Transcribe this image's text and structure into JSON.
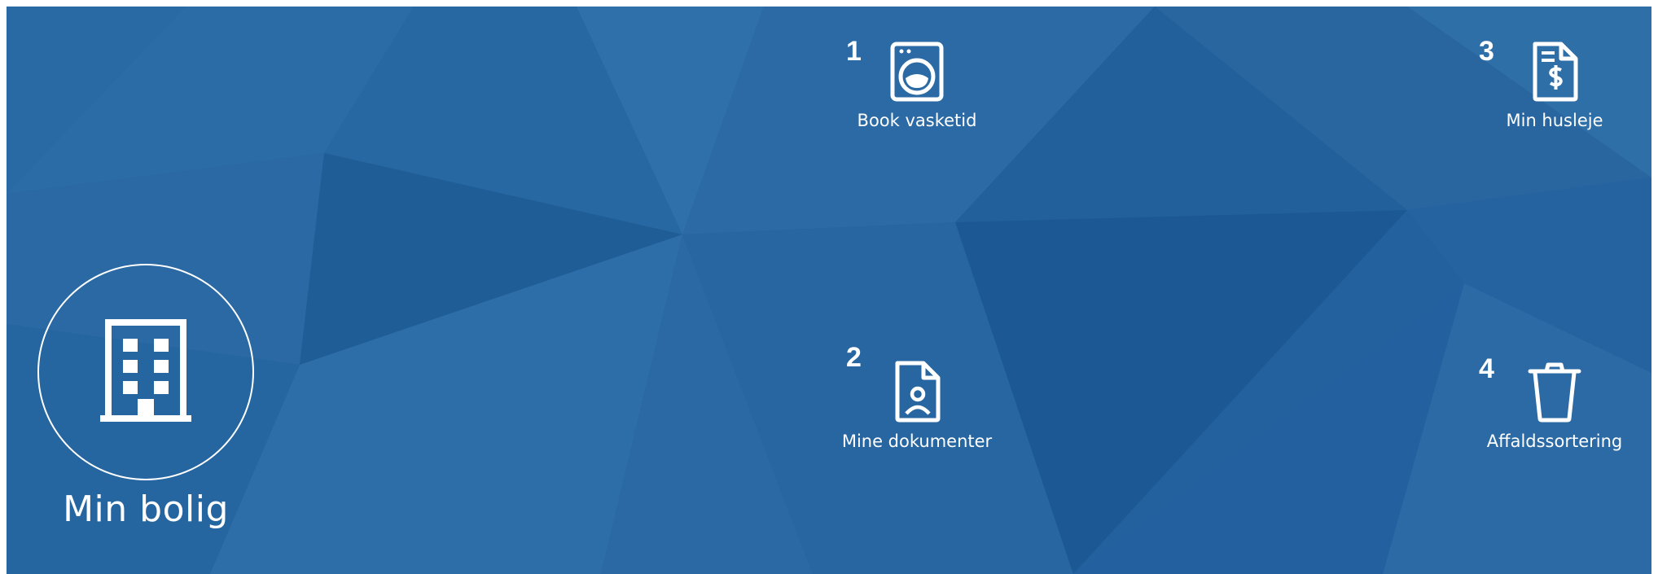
{
  "home": {
    "title": "Min bolig",
    "icon": "building-icon"
  },
  "tiles": [
    {
      "number": "1",
      "label": "Book vasketid",
      "icon": "washing-machine-icon"
    },
    {
      "number": "2",
      "label": "Mine dokumenter",
      "icon": "document-user-icon"
    },
    {
      "number": "3",
      "label": "Min husleje",
      "icon": "invoice-dollar-icon"
    },
    {
      "number": "4",
      "label": "Affaldssortering",
      "icon": "trash-can-icon"
    }
  ],
  "colors": {
    "background": "#24629c",
    "foreground": "#ffffff"
  }
}
